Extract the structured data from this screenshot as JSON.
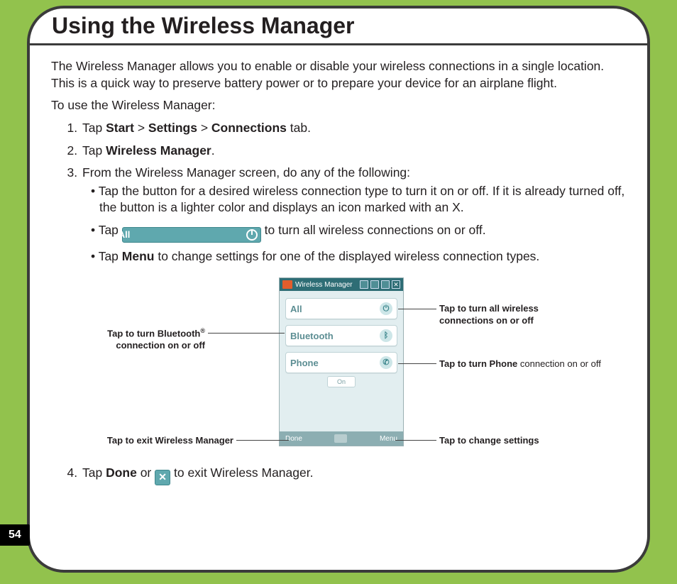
{
  "page_number": "54",
  "title": "Using the Wireless Manager",
  "intro": "The Wireless Manager allows you to enable or disable your wireless connections in a single location. This is a quick way to preserve battery power or to prepare your device for an airplane flight.",
  "lead_in": "To use the Wireless Manager:",
  "steps": {
    "s1": {
      "pre": "Tap ",
      "a": "Start",
      "sep1": " > ",
      "b": "Settings",
      "sep2": " > ",
      "c": "Connections",
      "post": " tab."
    },
    "s2": {
      "pre": "Tap ",
      "a": "Wireless Manager",
      "post": "."
    },
    "s3": {
      "text": "From the Wireless Manager screen, do any of the following:"
    },
    "s3_b1": "Tap the button for a desired wireless connection type to turn it on or off. If it is already turned off, the button is a lighter color and displays an icon marked with an X.",
    "s3_b2": {
      "pre": "Tap ",
      "btn": "All",
      "post": " to turn all wireless connections on or off."
    },
    "s3_b3": {
      "pre": "Tap ",
      "a": "Menu",
      "post": " to change settings for one of the displayed wireless connection types."
    },
    "s4": {
      "pre": "Tap ",
      "a": "Done",
      "mid": " or ",
      "post": " to exit Wireless Manager."
    }
  },
  "phone": {
    "window_title": "Wireless Manager",
    "btn_all": "All",
    "btn_bt": "Bluetooth",
    "btn_phone": "Phone",
    "chip": "On",
    "soft_left": "Done",
    "soft_right": "Menu"
  },
  "callouts": {
    "left_bt_a": "Tap to turn Bluetooth",
    "left_bt_b": "connection on or off",
    "left_exit": "Tap to exit Wireless Manager",
    "right_all_a": "Tap to turn all wireless",
    "right_all_b": "connections on or off",
    "right_phone_a": "Tap to turn ",
    "right_phone_b": "Phone",
    "right_phone_c": " connection on or off",
    "right_settings": "Tap to change settings"
  }
}
